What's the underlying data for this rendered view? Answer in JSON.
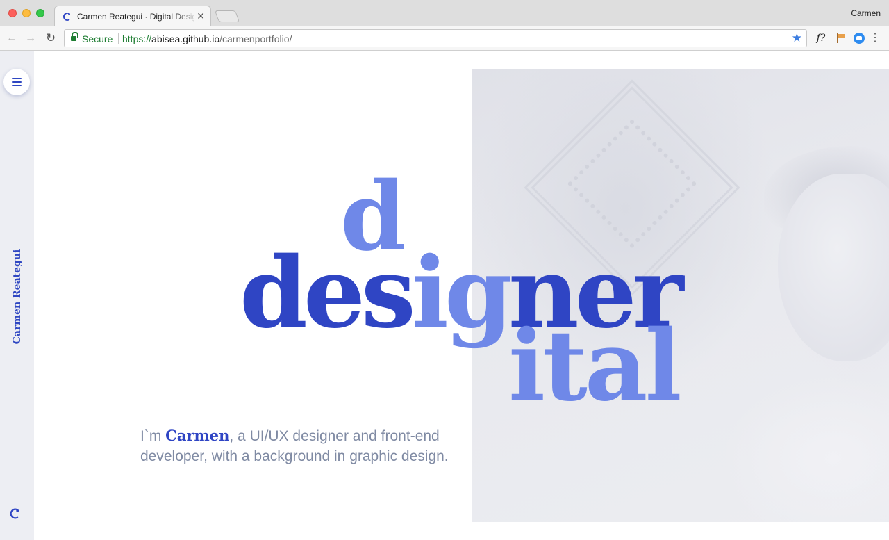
{
  "browser": {
    "tab_title": "Carmen Reategui · Digital Designer",
    "close_glyph": "✕",
    "profile_name": "Carmen",
    "nav": {
      "back": "←",
      "forward": "→",
      "reload": "↻"
    },
    "address": {
      "security_label": "Secure",
      "scheme": "https://",
      "host": "abisea.github.io",
      "path": "/carmenportfolio/"
    },
    "bookmark_glyph": "★",
    "extension_f_label": "f?",
    "menu_glyph": "⋮",
    "icons": [
      "lock-icon",
      "star-icon",
      "fontface-extension-icon",
      "flag-extension-icon",
      "screencast-extension-icon",
      "chrome-menu-icon"
    ]
  },
  "sidebar": {
    "name": "Carmen Reategui",
    "icons": [
      "hamburger-menu-icon",
      "carmen-logo-icon"
    ]
  },
  "hero": {
    "word_top": "d",
    "word_main_prefix": "des",
    "word_main_highlight": "ig",
    "word_main_suffix": "ner",
    "word_bottom": "ital",
    "intro_prefix": "I`m ",
    "intro_name": "Carmen",
    "intro_rest": ", a UI/UX designer and front-end developer, with a background in graphic design."
  },
  "colors": {
    "primary_blue": "#2f45c4",
    "light_blue": "#6f88e8",
    "text_gray": "#7f8aa3",
    "sidebar_bg": "#edeef3"
  }
}
